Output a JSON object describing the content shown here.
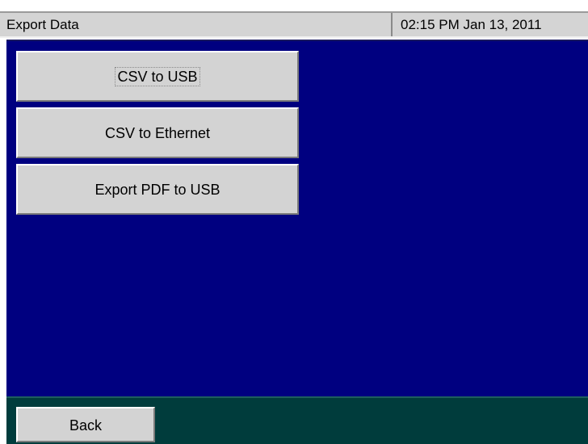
{
  "title_bar": {
    "title": "Export Data",
    "datetime": "02:15 PM Jan 13, 2011"
  },
  "menu": {
    "items": [
      {
        "label": "CSV to USB",
        "focused": true
      },
      {
        "label": "CSV to Ethernet",
        "focused": false
      },
      {
        "label": "Export PDF to USB",
        "focused": false
      }
    ]
  },
  "footer": {
    "back_label": "Back"
  },
  "colors": {
    "content_background": "#000080",
    "footer_background": "#003c3c",
    "button_face": "#d3d3d3",
    "title_bar": "#d4d4d4"
  }
}
